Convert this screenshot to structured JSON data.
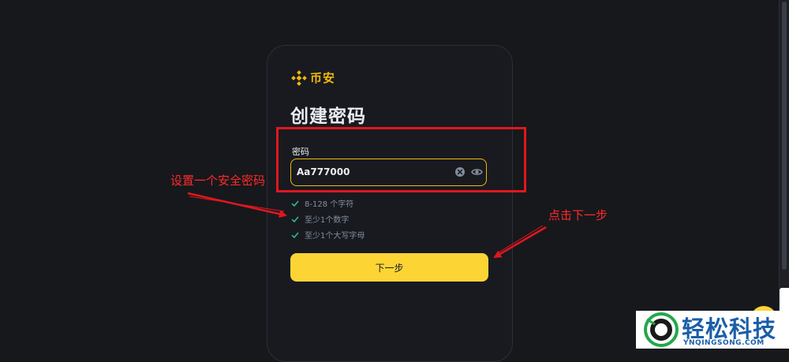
{
  "brand": {
    "name": "币安",
    "color": "#f0b90b",
    "icon": "binance-diamond-icon"
  },
  "page": {
    "title": "创建密码"
  },
  "password_field": {
    "label": "密码",
    "value": "Aa777000",
    "clear_icon": "clear-circle-icon",
    "toggle_icon": "eye-icon"
  },
  "requirements": [
    {
      "text": "8-128 个字符",
      "met": true
    },
    {
      "text": "至少1个数字",
      "met": true
    },
    {
      "text": "至少1个大写字母",
      "met": true
    }
  ],
  "next_button": {
    "label": "下一步",
    "color": "#fcd535"
  },
  "annotations": {
    "set_password": "设置一个安全密码",
    "click_next": "点击下一步",
    "color": "#e0171e"
  },
  "watermark": {
    "title": "轻松科技",
    "subtitle": "YNQINGSONG.COM"
  }
}
